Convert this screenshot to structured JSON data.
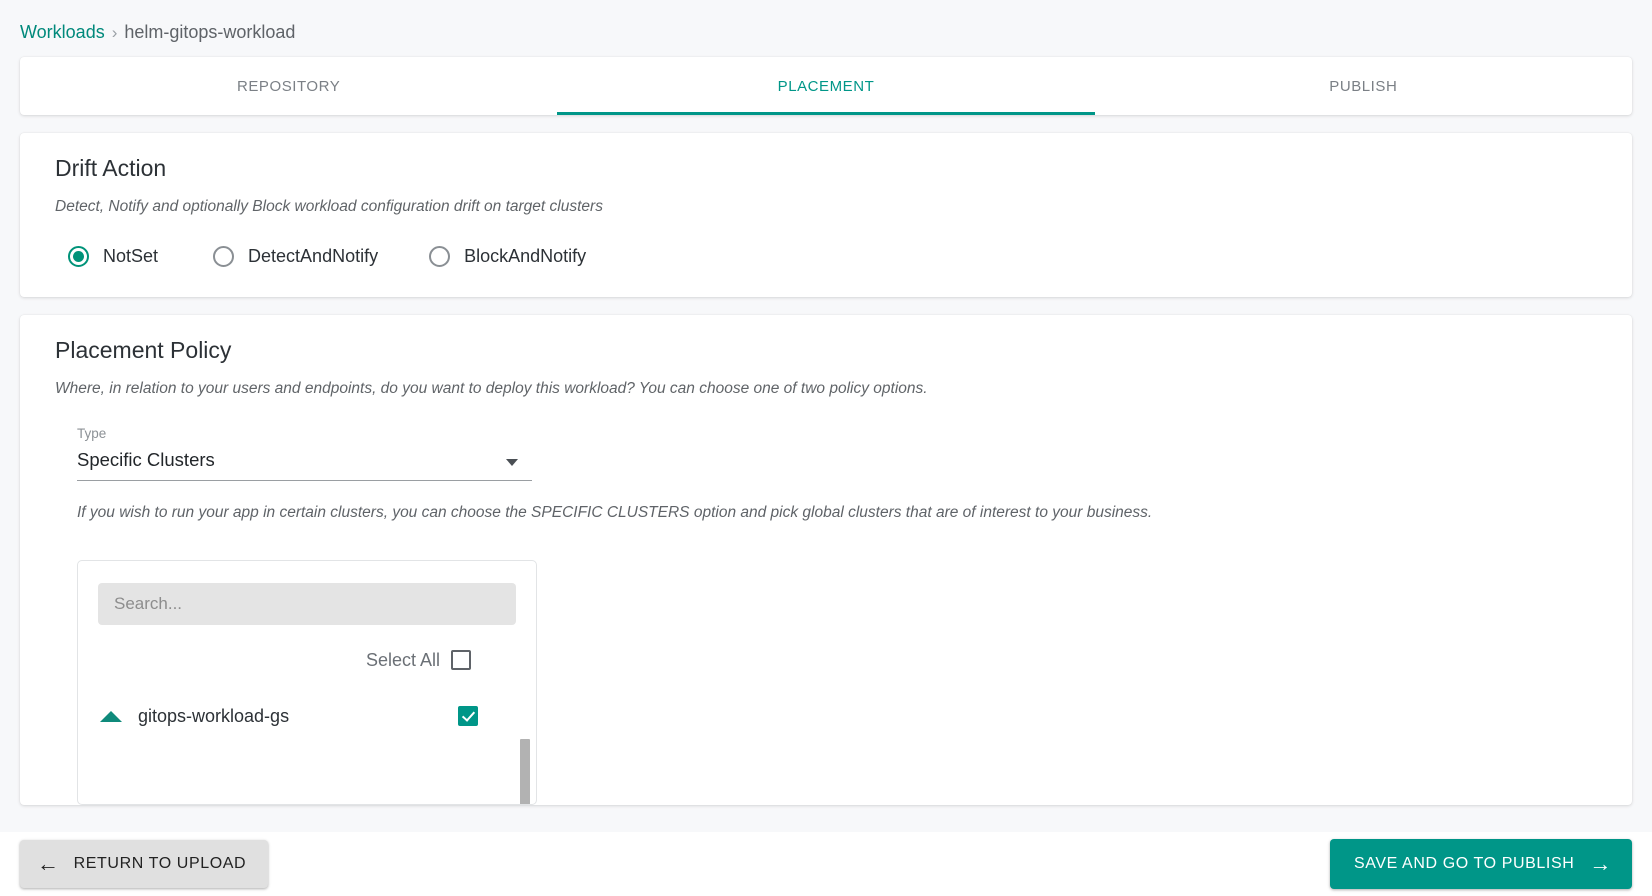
{
  "breadcrumb": {
    "root_label": "Workloads",
    "separator": "›",
    "current_label": "helm-gitops-workload"
  },
  "tabs": [
    {
      "label": "REPOSITORY",
      "active": false
    },
    {
      "label": "PLACEMENT",
      "active": true
    },
    {
      "label": "PUBLISH",
      "active": false
    }
  ],
  "drift_action": {
    "title": "Drift Action",
    "description": "Detect, Notify and optionally Block workload configuration drift on target clusters",
    "options": [
      {
        "label": "NotSet",
        "selected": true
      },
      {
        "label": "DetectAndNotify",
        "selected": false
      },
      {
        "label": "BlockAndNotify",
        "selected": false
      }
    ]
  },
  "placement_policy": {
    "title": "Placement Policy",
    "description": "Where, in relation to your users and endpoints, do you want to deploy this workload? You can choose one of two policy options.",
    "type_field": {
      "label": "Type",
      "value": "Specific Clusters",
      "caret_icon": "chevron-down-icon"
    },
    "hint": "If you wish to run your app in certain clusters, you can choose the SPECIFIC CLUSTERS option and pick global clusters that are of interest to your business.",
    "cluster_picker": {
      "search_placeholder": "Search...",
      "search_value": "",
      "select_all_label": "Select All",
      "select_all_checked": false,
      "clusters": [
        {
          "name": "gitops-workload-gs",
          "checked": true,
          "expand_icon": "triangle-up-icon"
        }
      ]
    }
  },
  "footer": {
    "back_button": {
      "label": "RETURN TO UPLOAD",
      "icon": "arrow-left-icon",
      "glyph": "←"
    },
    "next_button": {
      "label": "SAVE AND GO TO PUBLISH",
      "icon": "arrow-right-icon",
      "glyph": "→"
    }
  },
  "colors": {
    "accent_teal": "#009688",
    "accent_teal_dark": "#009379",
    "page_background": "#f7f8fa",
    "card_background": "#ffffff",
    "text_primary": "#2c3136",
    "text_muted": "#6b7280"
  }
}
